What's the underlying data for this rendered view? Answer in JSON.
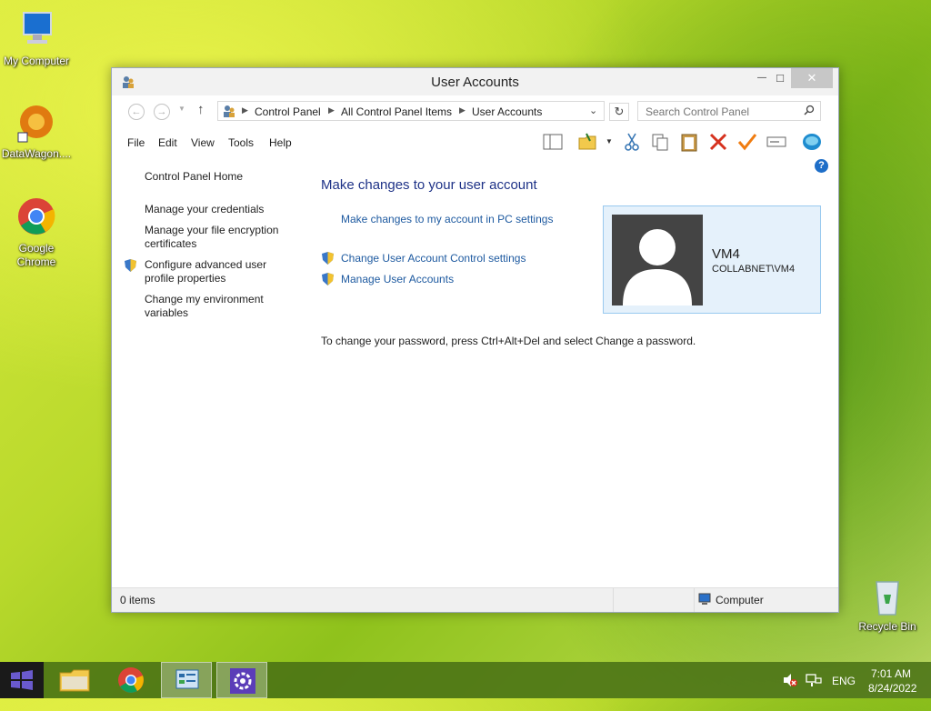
{
  "desktop": {
    "icons": [
      {
        "label": "My Computer",
        "icon": "computer-icon"
      },
      {
        "label": "DataWagon....",
        "icon": "datawagon-icon"
      },
      {
        "label": "Google Chrome",
        "icon": "chrome-icon"
      },
      {
        "label": "Recycle Bin",
        "icon": "recycle-bin-icon"
      }
    ]
  },
  "window": {
    "title": "User Accounts",
    "minimize": "—",
    "maximize": "□",
    "close": "✕"
  },
  "address": {
    "crumbs": [
      "Control Panel",
      "All Control Panel Items",
      "User Accounts"
    ],
    "search_placeholder": "Search Control Panel"
  },
  "menu": [
    "File",
    "Edit",
    "View",
    "Tools",
    "Help"
  ],
  "left_pane": {
    "home": "Control Panel Home",
    "links": [
      {
        "label": "Manage your credentials",
        "shield": false
      },
      {
        "label": "Manage your file encryption certificates",
        "shield": false
      },
      {
        "label": "Configure advanced user profile properties",
        "shield": true
      },
      {
        "label": "Change my environment variables",
        "shield": false
      }
    ]
  },
  "main": {
    "title": "Make changes to your user account",
    "pc_settings_link": "Make changes to my account in PC settings",
    "uac_link": "Change User Account Control settings",
    "manage_link": "Manage User Accounts",
    "password_text": "To change your password, press Ctrl+Alt+Del and select Change a password."
  },
  "profile": {
    "name": "VM4",
    "domain": "COLLABNET\\VM4"
  },
  "status": {
    "items": "0 items",
    "location": "Computer"
  },
  "taskbar": {
    "lang": "ENG",
    "time": "7:01 AM",
    "date": "8/24/2022"
  },
  "colors": {
    "link": "#1e5aa0",
    "title": "#1e3287",
    "profile_bg": "#e5f1fb"
  }
}
